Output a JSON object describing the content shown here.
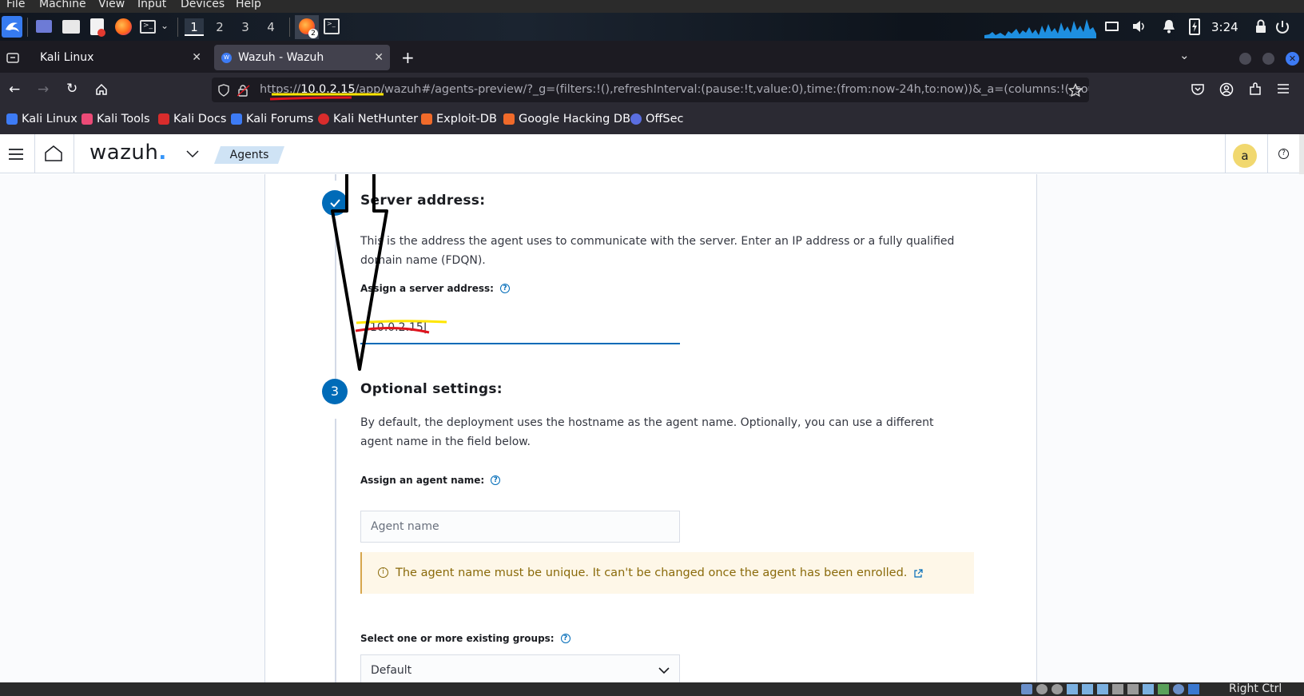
{
  "vm_menu": [
    "File",
    "Machine",
    "View",
    "Input",
    "Devices",
    "Help"
  ],
  "panel": {
    "workspaces": [
      "1",
      "2",
      "3",
      "4"
    ],
    "firefox_badge": "2",
    "clock": "3:24"
  },
  "tabs": [
    {
      "label": "Kali Linux",
      "active": false
    },
    {
      "label": "Wazuh - Wazuh",
      "active": true
    }
  ],
  "url": {
    "scheme": "https://",
    "host": "10.0.2.15",
    "rest": "/app/wazuh#/agents-preview/?_g=(filters:!(),refreshInterval:(pause:!t,value:0),time:(from:now-24h,to:now))&_a=(columns:!(_source"
  },
  "bookmarks": [
    "Kali Linux",
    "Kali Tools",
    "Kali Docs",
    "Kali Forums",
    "Kali NetHunter",
    "Exploit-DB",
    "Google Hacking DB",
    "OffSec"
  ],
  "wazuh": {
    "logo": "wazuh",
    "logo_dot": ".",
    "breadcrumb": "Agents",
    "avatar_letter": "a"
  },
  "server_step": {
    "title": "Server address:",
    "description": "This is the address the agent uses to communicate with the server. Enter an IP address or a fully qualified domain name (FDQN).",
    "field_label": "Assign a server address:",
    "field_value": "10.0.2.15"
  },
  "optional_step": {
    "number": "3",
    "title": "Optional settings:",
    "description": "By default, the deployment uses the hostname as the agent name. Optionally, you can use a different agent name in the field below.",
    "name_label": "Assign an agent name:",
    "name_placeholder": "Agent name",
    "callout": "The agent name must be unique. It can't be changed once the agent has been enrolled.",
    "groups_label": "Select one or more existing groups:",
    "groups_value": "Default"
  },
  "statusbar": {
    "host_key": "Right Ctrl"
  },
  "colors": {
    "accent": "#006bb8",
    "annotation_yellow": "#ffe600",
    "annotation_red": "#e0141e"
  }
}
